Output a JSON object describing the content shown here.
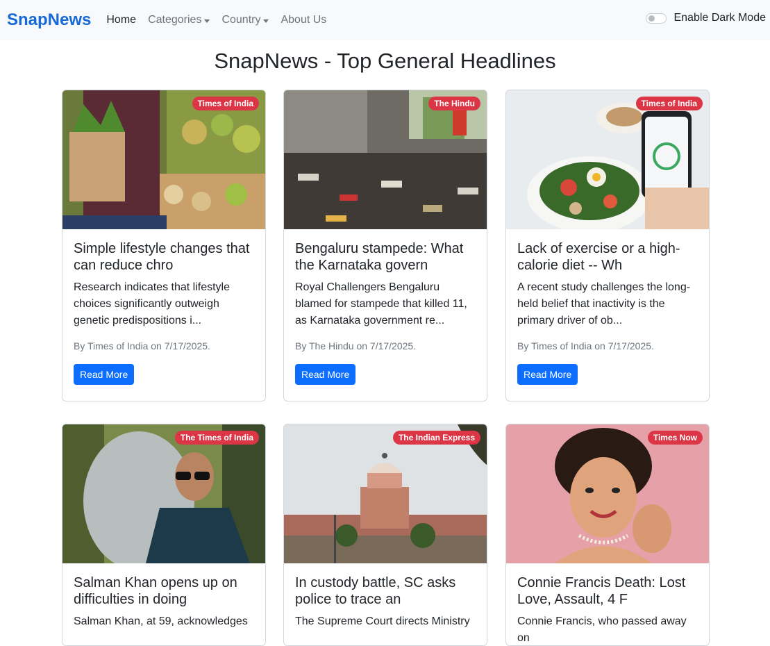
{
  "nav": {
    "brand": "SnapNews",
    "links": [
      "Home",
      "Categories",
      "Country",
      "About Us"
    ],
    "dark_mode_label": "Enable Dark Mode"
  },
  "page_title": "SnapNews - Top General Headlines",
  "colors": {
    "brand": "#1669d6",
    "badge": "#dc3545",
    "button": "#0d6efd",
    "navbar_bg": "#f8f9fa"
  },
  "articles": [
    {
      "source": "Times of India",
      "title": "Simple lifestyle changes that can reduce chro",
      "description": "Research indicates that lifestyle choices significantly outweigh genetic predispositions i...",
      "meta": "By Times of India on 7/17/2025.",
      "button": "Read More",
      "image": "grocery-shopper-image"
    },
    {
      "source": "The Hindu",
      "title": "Bengaluru stampede: What the Karnataka govern",
      "description": "Royal Challengers Bengaluru blamed for stampede that killed 11, as Karnataka government re...",
      "meta": "By The Hindu on 7/17/2025.",
      "button": "Read More",
      "image": "stampede-shoes-image"
    },
    {
      "source": "Times of India",
      "title": "Lack of exercise or a high-calorie diet -- Wh",
      "description": "A recent study challenges the long-held belief that inactivity is the primary driver of ob...",
      "meta": "By Times of India on 7/17/2025.",
      "button": "Read More",
      "image": "salad-phone-image"
    },
    {
      "source": "The Times of India",
      "title": "Salman Khan opens up on difficulties in doing",
      "description": "Salman Khan, at 59, acknowledges",
      "meta": "",
      "button": "",
      "image": "salman-khan-image"
    },
    {
      "source": "The Indian Express",
      "title": "In custody battle, SC asks police to trace an",
      "description": "The Supreme Court directs Ministry",
      "meta": "",
      "button": "",
      "image": "supreme-court-image"
    },
    {
      "source": "Times Now",
      "title": "Connie Francis Death: Lost Love, Assault, 4 F",
      "description": "Connie Francis, who passed away on",
      "meta": "",
      "button": "",
      "image": "connie-francis-image"
    }
  ]
}
